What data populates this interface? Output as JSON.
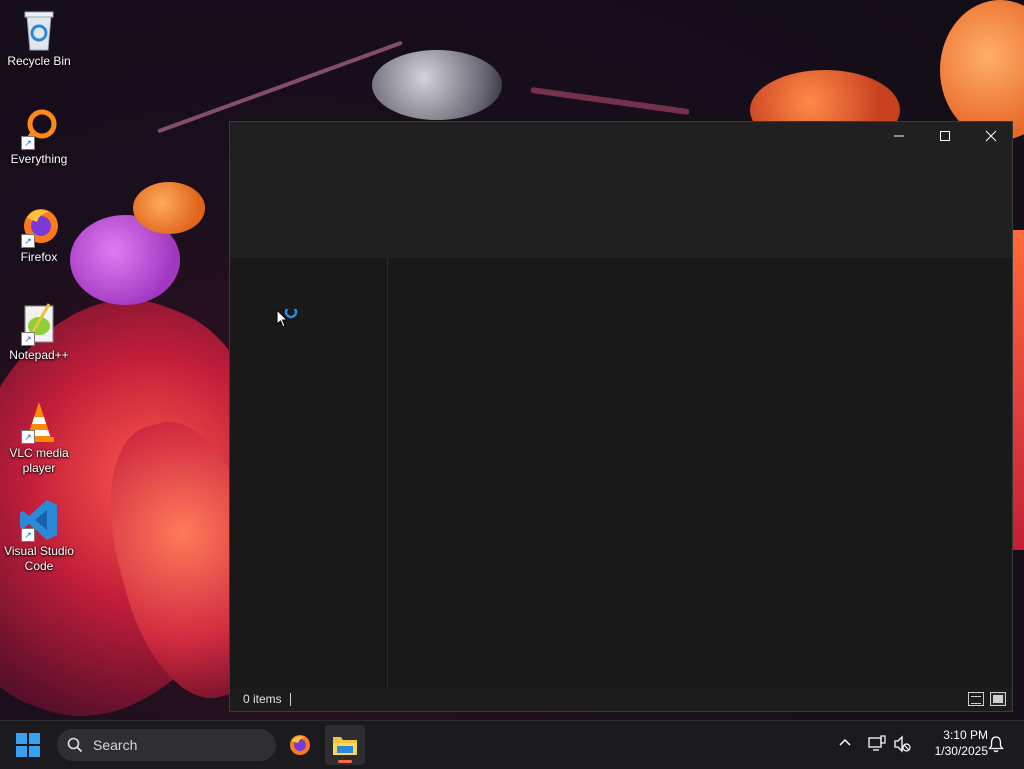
{
  "desktop": {
    "icons": [
      {
        "label": "Recycle Bin"
      },
      {
        "label": "Everything"
      },
      {
        "label": "Firefox"
      },
      {
        "label": "Notepad++"
      },
      {
        "label": "VLC media player"
      },
      {
        "label": "Visual Studio Code"
      }
    ]
  },
  "window": {
    "status": {
      "item_count": "0 items"
    }
  },
  "taskbar": {
    "search_label": "Search",
    "clock": {
      "time": "3:10 PM",
      "date": "1/30/2025"
    }
  },
  "colors": {
    "accent": "#3aa0f0",
    "window_bg": "#1c1c1c",
    "taskbar_bg": "#1b1b1f"
  }
}
